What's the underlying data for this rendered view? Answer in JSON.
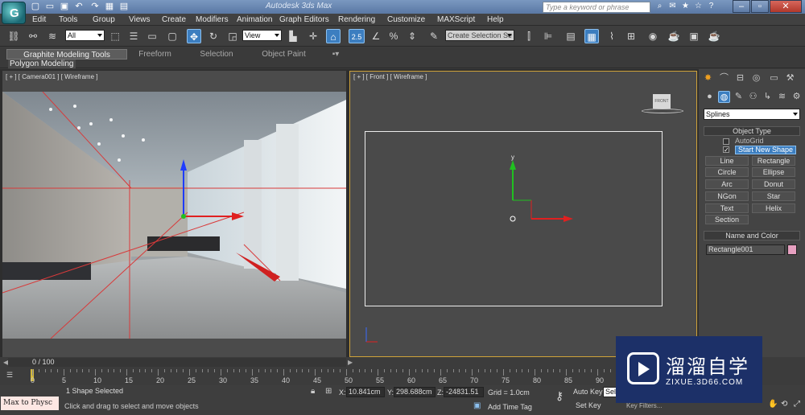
{
  "titlebar": {
    "app_logo_letter": "G",
    "title": "Autodesk 3ds Max",
    "search_placeholder": "Type a keyword or phrase",
    "accent": "#5a78a4"
  },
  "menu": {
    "items": [
      "Edit",
      "Tools",
      "Group",
      "Views",
      "Create",
      "Modifiers",
      "Animation",
      "Graph Editors",
      "Rendering",
      "Customize",
      "MAXScript",
      "Help"
    ]
  },
  "toolbar": {
    "filter_value": "All",
    "refcoord_value": "View",
    "snap_label": "2.5",
    "selection_set_placeholder": "Create Selection Se"
  },
  "ribbon": {
    "tabs": [
      "Graphite Modeling Tools",
      "Freeform",
      "Selection",
      "Object Paint"
    ],
    "sub_label": "Polygon Modeling"
  },
  "viewports": {
    "left_label": "[ + ] [ Camera001 ] [ Wireframe ]",
    "right_label": "[ + ] [ Front ] [ Wireframe ]",
    "viewcube_label": "FRONT",
    "gizmo_z": "z",
    "gizmo_y": "y",
    "gizmo_x": "x"
  },
  "command_panel": {
    "category_value": "Splines",
    "object_type_title": "Object Type",
    "autogrid_label": "AutoGrid",
    "start_new_shape_label": "Start New Shape",
    "shape_buttons": [
      "Line",
      "Rectangle",
      "Circle",
      "Ellipse",
      "Arc",
      "Donut",
      "NGon",
      "Star",
      "Text",
      "Helix",
      "Section"
    ],
    "name_color_title": "Name and Color",
    "object_name": "Rectangle001",
    "object_color": "#e6a0c0"
  },
  "timeline": {
    "frame_counter": "0 / 100",
    "ticks": [
      "0",
      "5",
      "10",
      "15",
      "20",
      "25",
      "30",
      "35",
      "40",
      "45",
      "50",
      "55",
      "60",
      "65",
      "70",
      "75",
      "80",
      "85",
      "90"
    ]
  },
  "status": {
    "maxscript_label": "Max to Physc",
    "selection_status": "1 Shape Selected",
    "prompt": "Click and drag to select and move objects",
    "x_label": "X:",
    "x_value": "10.841cm",
    "y_label": "Y:",
    "y_value": "298.688cm",
    "z_label": "Z:",
    "z_value": "-24831.51",
    "grid": "Grid = 1.0cm",
    "add_time_tag": "Add Time Tag",
    "auto_key": "Auto Key",
    "selected_value": "Sele",
    "set_key": "Set Key",
    "key_filters": "Key Filters..."
  },
  "watermark": {
    "cn_text": "溜溜自学",
    "url": "ZIXUE.3D66.COM",
    "bg": "#1c3068"
  }
}
